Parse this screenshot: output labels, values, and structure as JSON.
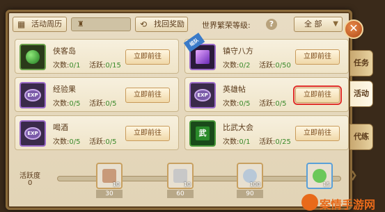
{
  "toolbar": {
    "calendar_label": "活动周历",
    "find_reward_label": "找回奖励",
    "level_label": "世界繁荣等级:",
    "help": "?",
    "filter_selected": "全 部"
  },
  "close_label": "✕",
  "side_tabs": [
    {
      "label": "任务",
      "active": false
    },
    {
      "label": "活动",
      "active": true
    },
    {
      "label": "代练",
      "active": false
    }
  ],
  "cards": [
    {
      "title": "侠客岛",
      "count_label": "次数:",
      "count": "0/1",
      "active_label": "活跃:",
      "active": "0/15",
      "button": "立即前往",
      "icon": "jade-staff-icon"
    },
    {
      "title": "镇守八方",
      "count_label": "次数:",
      "count": "0/2",
      "active_label": "活跃:",
      "active": "0/50",
      "button": "立即前往",
      "icon": "purple-crystal-icon",
      "badge": "组队"
    },
    {
      "title": "经验果",
      "count_label": "次数:",
      "count": "0/5",
      "active_label": "活跃:",
      "active": "0/5",
      "button": "立即前往",
      "icon": "exp-orb-icon",
      "icon_text": "EXP"
    },
    {
      "title": "英雄帖",
      "count_label": "次数:",
      "count": "0/5",
      "active_label": "活跃:",
      "active": "0/5",
      "button": "立即前往",
      "icon": "exp-orb-icon",
      "icon_text": "EXP"
    },
    {
      "title": "喝酒",
      "count_label": "次数:",
      "count": "0/5",
      "active_label": "活跃:",
      "active": "0/5",
      "button": "立即前往",
      "icon": "exp-orb-icon",
      "icon_text": "EXP"
    },
    {
      "title": "比武大会",
      "count_label": "次数:",
      "count": "0/1",
      "active_label": "活跃:",
      "active": "0/25",
      "button": "立即前往",
      "icon": "martial-book-icon",
      "icon_text": "武"
    }
  ],
  "activity": {
    "label": "活跃度",
    "value": "0",
    "rewards": [
      {
        "points": "30",
        "qty": "10",
        "icon": "wing-cloak-icon"
      },
      {
        "points": "60",
        "qty": "10",
        "icon": "silver-ingot-icon"
      },
      {
        "points": "90",
        "qty": "100",
        "icon": "silver-coin-icon"
      },
      {
        "points": "",
        "qty": "15",
        "icon": "green-gem-icon"
      }
    ]
  },
  "watermark": "案情手游网",
  "colors": {
    "accent": "#e0302a",
    "green": "#3a8a2a",
    "panel": "#e8dcc4"
  }
}
